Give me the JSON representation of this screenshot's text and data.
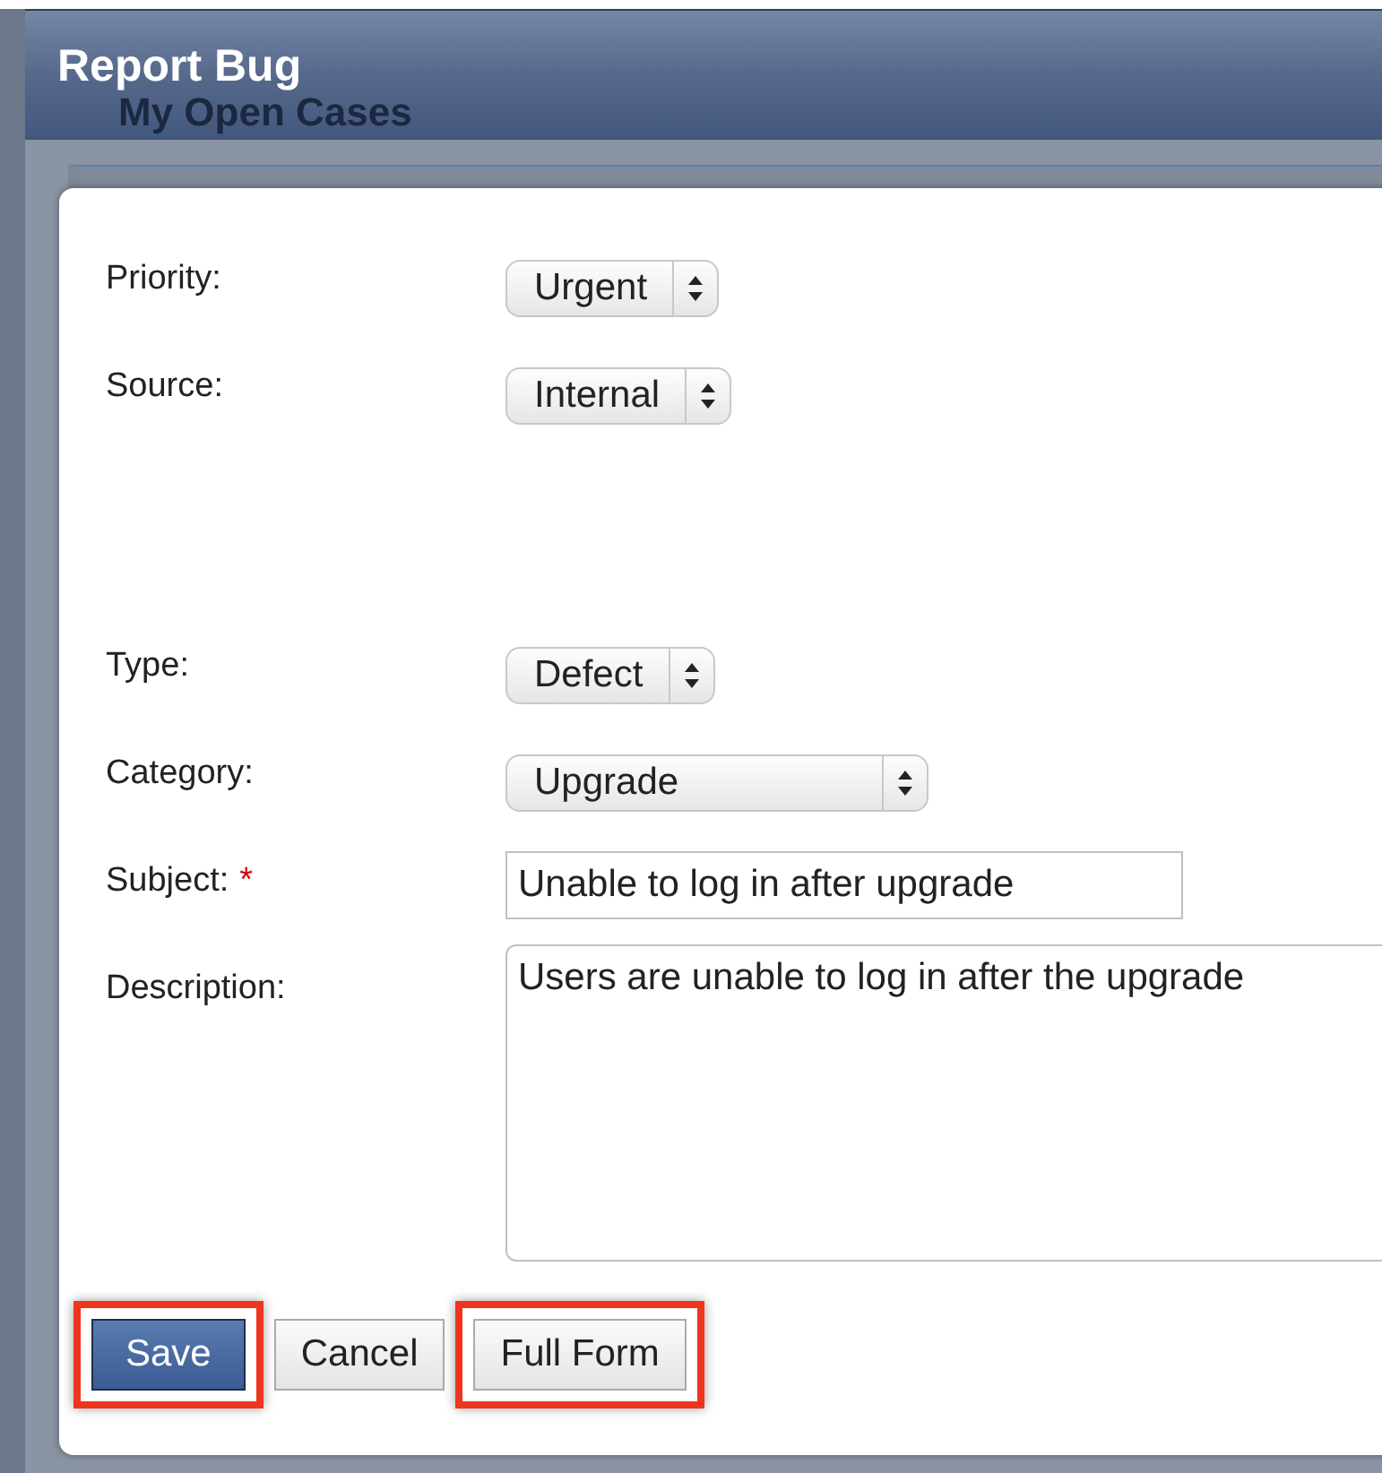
{
  "dialog": {
    "title": "Report Bug"
  },
  "background": {
    "panel_title": "My Open Cases"
  },
  "fields": [
    {
      "kind": "select",
      "label": "Priority:",
      "value": "Urgent"
    },
    {
      "kind": "select",
      "label": "Source:",
      "value": "Internal"
    },
    {
      "kind": "spacer"
    },
    {
      "kind": "select",
      "label": "Type:",
      "value": "Defect"
    },
    {
      "kind": "select",
      "label": "Category:",
      "value": "Upgrade",
      "wide": true
    },
    {
      "kind": "text",
      "label": "Subject:",
      "required_mark": "*",
      "value": "Unable to log in after upgrade"
    },
    {
      "kind": "textarea",
      "label": "Description:",
      "value": "Users are unable to log in after the upgrade"
    }
  ],
  "buttons": [
    {
      "label": "Save",
      "kind": "primary",
      "highlighted": true
    },
    {
      "label": "Cancel",
      "kind": "default",
      "highlighted": false
    },
    {
      "label": "Full Form",
      "kind": "default",
      "highlighted": true
    }
  ]
}
